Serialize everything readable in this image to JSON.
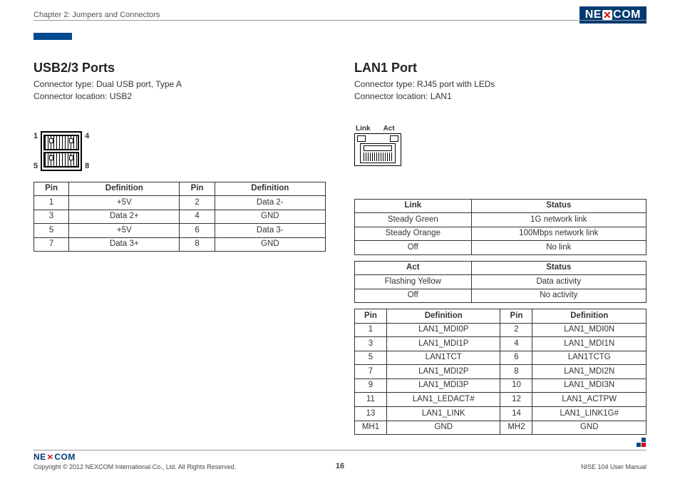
{
  "header": {
    "chapter": "Chapter 2: Jumpers and Connectors",
    "logo": "NEXCOM"
  },
  "usb": {
    "title": "USB2/3 Ports",
    "type": "Connector type: Dual USB port, Type A",
    "location": "Connector location: USB2",
    "pins": {
      "p1": "1",
      "p4": "4",
      "p5": "5",
      "p8": "8"
    },
    "table": {
      "headers": {
        "h1": "Pin",
        "h2": "Definition",
        "h3": "Pin",
        "h4": "Definition"
      },
      "rows": [
        {
          "c1": "1",
          "c2": "+5V",
          "c3": "2",
          "c4": "Data 2-"
        },
        {
          "c1": "3",
          "c2": "Data 2+",
          "c3": "4",
          "c4": "GND"
        },
        {
          "c1": "5",
          "c2": "+5V",
          "c3": "6",
          "c4": "Data 3-"
        },
        {
          "c1": "7",
          "c2": "Data 3+",
          "c3": "8",
          "c4": "GND"
        }
      ]
    }
  },
  "lan": {
    "title": "LAN1 Port",
    "type": "Connector type: RJ45 port with LEDs",
    "location": "Connector location: LAN1",
    "diagram": {
      "link": "Link",
      "act": "Act"
    },
    "tlink": {
      "headers": {
        "h1": "Link",
        "h2": "Status"
      },
      "rows": [
        {
          "c1": "Steady Green",
          "c2": "1G network link"
        },
        {
          "c1": "Steady Orange",
          "c2": "100Mbps network link"
        },
        {
          "c1": "Off",
          "c2": "No link"
        }
      ]
    },
    "tact": {
      "headers": {
        "h1": "Act",
        "h2": "Status"
      },
      "rows": [
        {
          "c1": "Flashing Yellow",
          "c2": "Data activity"
        },
        {
          "c1": "Off",
          "c2": "No activity"
        }
      ]
    },
    "tpin": {
      "headers": {
        "h1": "Pin",
        "h2": "Definition",
        "h3": "Pin",
        "h4": "Definition"
      },
      "rows": [
        {
          "c1": "1",
          "c2": "LAN1_MDI0P",
          "c3": "2",
          "c4": "LAN1_MDI0N"
        },
        {
          "c1": "3",
          "c2": "LAN1_MDI1P",
          "c3": "4",
          "c4": "LAN1_MDI1N"
        },
        {
          "c1": "5",
          "c2": "LAN1TCT",
          "c3": "6",
          "c4": "LAN1TCTG"
        },
        {
          "c1": "7",
          "c2": "LAN1_MDI2P",
          "c3": "8",
          "c4": "LAN1_MDI2N"
        },
        {
          "c1": "9",
          "c2": "LAN1_MDI3P",
          "c3": "10",
          "c4": "LAN1_MDI3N"
        },
        {
          "c1": "11",
          "c2": "LAN1_LEDACT#",
          "c3": "12",
          "c4": "LAN1_ACTPW"
        },
        {
          "c1": "13",
          "c2": "LAN1_LINK",
          "c3": "14",
          "c4": "LAN1_LINK1G#"
        },
        {
          "c1": "MH1",
          "c2": "GND",
          "c3": "MH2",
          "c4": "GND"
        }
      ]
    }
  },
  "footer": {
    "copyright": "Copyright © 2012 NEXCOM International Co., Ltd. All Rights Reserved.",
    "page": "16",
    "manual": "NISE 104 User Manual"
  }
}
